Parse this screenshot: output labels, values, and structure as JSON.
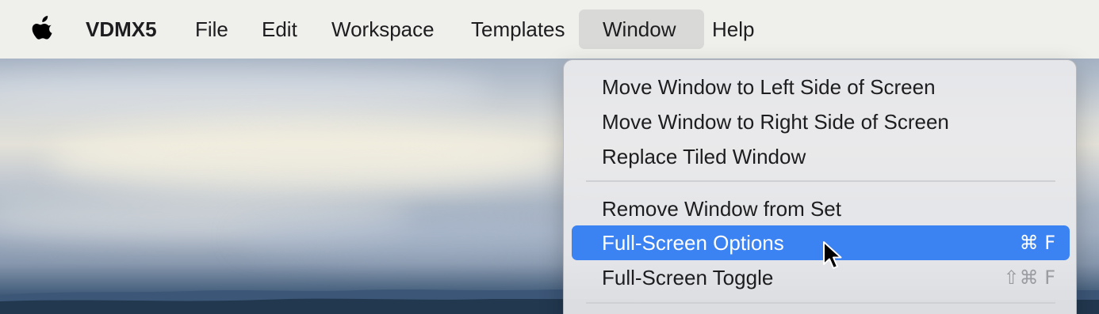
{
  "menubar": {
    "apple_icon": "apple-logo-icon",
    "items": [
      {
        "label": "VDMX5"
      },
      {
        "label": "File"
      },
      {
        "label": "Edit"
      },
      {
        "label": "Workspace"
      },
      {
        "label": "Templates"
      },
      {
        "label": "Window"
      },
      {
        "label": "Help"
      }
    ],
    "active": "Window"
  },
  "window_menu": {
    "items": [
      {
        "label": "Move Window to Left Side of Screen",
        "shortcut": ""
      },
      {
        "label": "Move Window to Right Side of Screen",
        "shortcut": ""
      },
      {
        "label": "Replace Tiled Window",
        "shortcut": ""
      },
      {
        "label": "Remove Window from Set",
        "shortcut": ""
      },
      {
        "label": "Full-Screen Options",
        "shortcut": "⌘ F"
      },
      {
        "label": "Full-Screen Toggle",
        "shortcut": "⇧⌘ F"
      }
    ],
    "highlighted": "Full-Screen Options"
  },
  "colors": {
    "menubar_bg": "#efefeb",
    "highlight": "#3b82f2",
    "active_menu_bg": "#d9dad7"
  },
  "cursor": "arrow-pointer-icon"
}
